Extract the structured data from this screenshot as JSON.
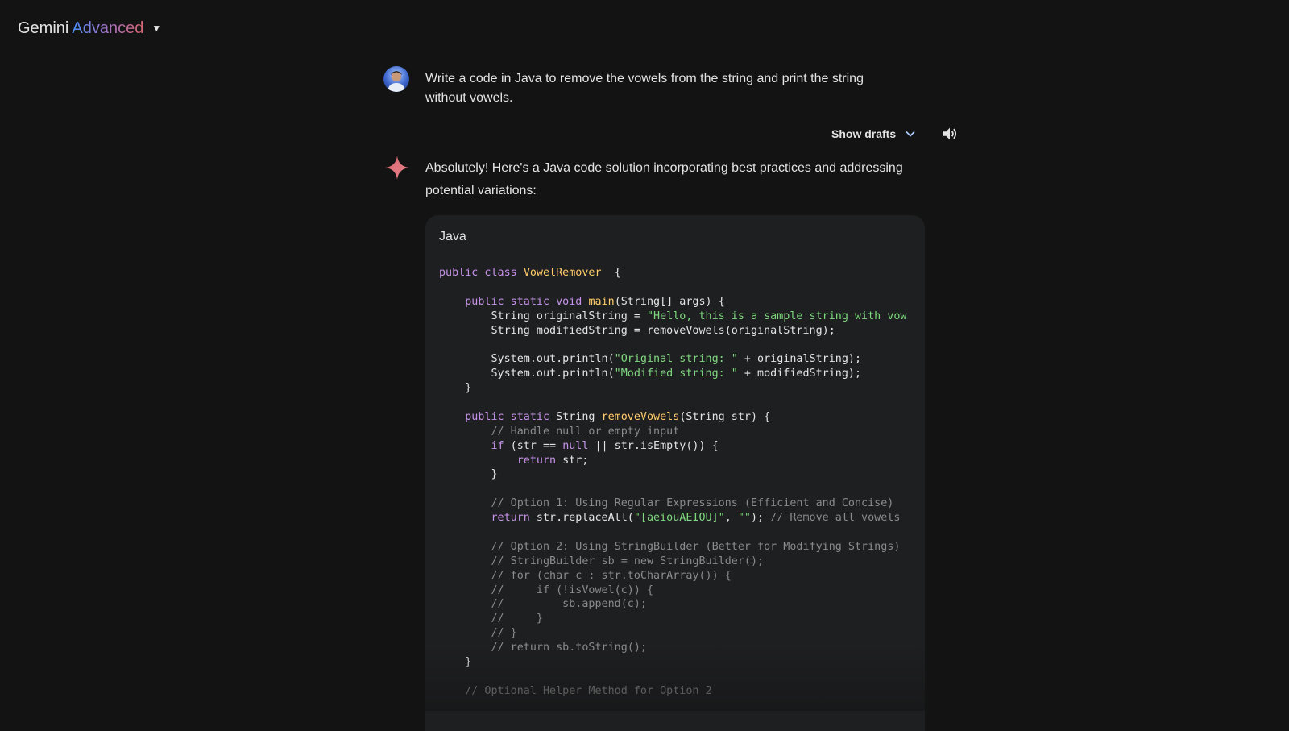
{
  "header": {
    "brand_name": "Gemini",
    "brand_tier": "Advanced",
    "menu_icon": "caret-down-icon"
  },
  "user_message": {
    "avatar_icon": "user-avatar",
    "text": "Write a code in Java to remove the vowels from the string and print the string without vowels."
  },
  "response_actions": {
    "show_drafts_label": "Show drafts",
    "expand_icon": "chevron-down-icon",
    "read_aloud_icon": "speaker-icon"
  },
  "response": {
    "icon": "gemini-sparkle-icon",
    "intro": "Absolutely! Here's a Java code solution incorporating best practices and addressing potential variations:",
    "code_block": {
      "language": "Java",
      "lines": [
        [
          [
            "kw",
            "public class "
          ],
          [
            "fn",
            "VowelRemover"
          ],
          [
            "",
            "  {"
          ]
        ],
        [],
        [
          [
            "",
            "    "
          ],
          [
            "kw",
            "public static void "
          ],
          [
            "fn",
            "main"
          ],
          [
            "",
            "(String[] args) {"
          ]
        ],
        [
          [
            "",
            "        String originalString = "
          ],
          [
            "st",
            "\"Hello, this is a sample string with vow"
          ]
        ],
        [
          [
            "",
            "        String modifiedString = removeVowels(originalString);"
          ]
        ],
        [],
        [
          [
            "",
            "        System.out.println("
          ],
          [
            "st",
            "\"Original string: \""
          ],
          [
            "",
            " + originalString);"
          ]
        ],
        [
          [
            "",
            "        System.out.println("
          ],
          [
            "st",
            "\"Modified string: \""
          ],
          [
            "",
            " + modifiedString);"
          ]
        ],
        [
          [
            "",
            "    }"
          ]
        ],
        [],
        [
          [
            "",
            "    "
          ],
          [
            "kw",
            "public static "
          ],
          [
            "",
            "String "
          ],
          [
            "fn",
            "removeVowels"
          ],
          [
            "",
            "(String str) {"
          ]
        ],
        [
          [
            "cm",
            "        // Handle null or empty input"
          ]
        ],
        [
          [
            "",
            "        "
          ],
          [
            "kw",
            "if"
          ],
          [
            "",
            " (str == "
          ],
          [
            "kw",
            "null"
          ],
          [
            "",
            " || str.isEmpty()) {"
          ]
        ],
        [
          [
            "",
            "            "
          ],
          [
            "kw",
            "return"
          ],
          [
            "",
            " str;"
          ]
        ],
        [
          [
            "",
            "        }"
          ]
        ],
        [],
        [
          [
            "cm",
            "        // Option 1: Using Regular Expressions (Efficient and Concise)"
          ]
        ],
        [
          [
            "",
            "        "
          ],
          [
            "kw",
            "return"
          ],
          [
            "",
            " str.replaceAll("
          ],
          [
            "st",
            "\"[aeiouAEIOU]\""
          ],
          [
            "",
            ", "
          ],
          [
            "st",
            "\"\""
          ],
          [
            "",
            "); "
          ],
          [
            "cm",
            "// Remove all vowels"
          ]
        ],
        [],
        [
          [
            "cm",
            "        // Option 2: Using StringBuilder (Better for Modifying Strings)"
          ]
        ],
        [
          [
            "cm",
            "        // StringBuilder sb = new StringBuilder();"
          ]
        ],
        [
          [
            "cm",
            "        // for (char c : str.toCharArray()) {"
          ]
        ],
        [
          [
            "cm",
            "        //     if (!isVowel(c)) {"
          ]
        ],
        [
          [
            "cm",
            "        //         sb.append(c);"
          ]
        ],
        [
          [
            "cm",
            "        //     }"
          ]
        ],
        [
          [
            "cm",
            "        // }"
          ]
        ],
        [
          [
            "cm",
            "        // return sb.toString();"
          ]
        ],
        [
          [
            "",
            "    }"
          ]
        ],
        [],
        [
          [
            "cm",
            "    // Optional Helper Method for Option 2"
          ]
        ]
      ]
    }
  },
  "colors": {
    "background": "#131314",
    "code_background": "#1e1f20",
    "keyword": "#c792ea",
    "function": "#ffcb6b",
    "string": "#7fd87f",
    "comment": "#8a8a8a"
  }
}
